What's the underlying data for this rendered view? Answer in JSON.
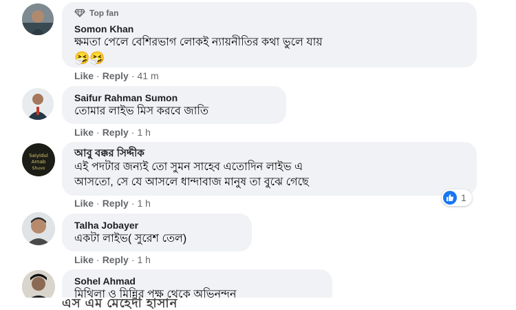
{
  "comments": [
    {
      "badge": "Top fan",
      "author": "Somon Khan",
      "text": "ক্ষমতা পেলে বেশিরভাগ লোকই ন্যায়নীতির কথা ভুলে যায়",
      "emoji": "🤧🤧",
      "like": "Like",
      "reply": "Reply",
      "time": "41 m"
    },
    {
      "author": "Saifur Rahman Sumon",
      "text": "তোমার লাইভ মিস করবে জাতি",
      "like": "Like",
      "reply": "Reply",
      "time": "1 h"
    },
    {
      "author": "আবু বক্কর সিদ্দীক",
      "text_line1": "এই পদটার জন্যই তো সুমন সাহেব এতোদিন লাইভ এ",
      "text_line2": "আসতো, সে যে আসলে ধান্দাবাজ মানুষ তা বুঝে গেছে",
      "reaction_count": "1",
      "like": "Like",
      "reply": "Reply",
      "time": "1 h"
    },
    {
      "author": "Talha Jobayer",
      "text": "একটা লাইভ( সুরেশ তেল)",
      "like": "Like",
      "reply": "Reply",
      "time": "1 h"
    },
    {
      "author": "Sohel Ahmad",
      "text": "মিথিলা ও মিন্নির পক্ষ থেকে অভিনন্দন"
    }
  ],
  "overlay_caption": "এস এম মেহেদী হাসান",
  "colors": {
    "like_blue": "#1877f2",
    "bubble_bg": "#f0f2f5",
    "meta_gray": "#65676b"
  }
}
